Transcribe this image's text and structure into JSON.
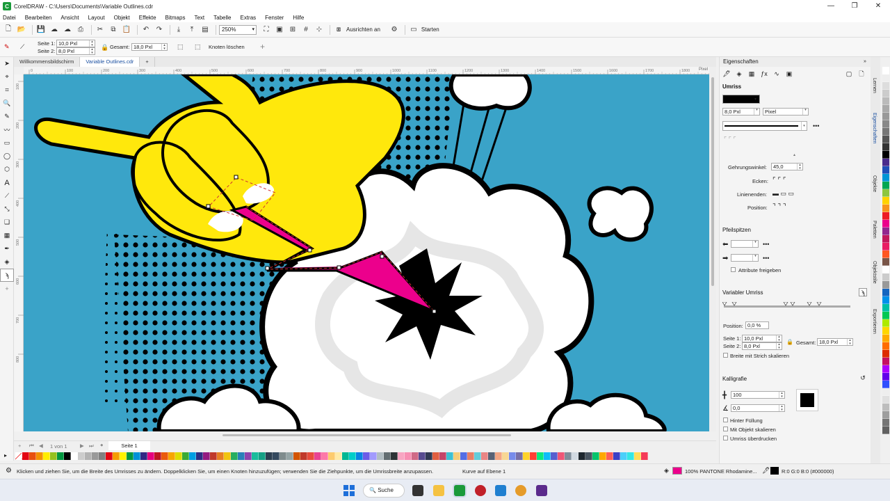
{
  "window": {
    "title": "CorelDRAW - C:\\Users\\Documents\\Variable Outlines.cdr",
    "controls": [
      "—",
      "❐",
      "✕"
    ]
  },
  "menu": [
    "Datei",
    "Bearbeiten",
    "Ansicht",
    "Layout",
    "Objekt",
    "Effekte",
    "Bitmaps",
    "Text",
    "Tabelle",
    "Extras",
    "Fenster",
    "Hilfe"
  ],
  "toolbar": {
    "zoom": "250%",
    "align_label": "Ausrichten an",
    "start_label": "Starten"
  },
  "propbar": {
    "side1_label": "Seite 1:",
    "side1_value": "10,0 Pxl",
    "side2_label": "Seite 2:",
    "side2_value": "8,0 Pxl",
    "total_label": "Gesamt:",
    "total_value": "18,0 Pxl",
    "delete_nodes": "Knoten löschen"
  },
  "tabs": [
    "Willkommensbildschirm",
    "Variable Outlines.cdr"
  ],
  "ruler": {
    "h_ticks": [
      "0",
      "100",
      "200",
      "300",
      "400",
      "500",
      "600",
      "700",
      "800",
      "900",
      "1000",
      "1100",
      "1200",
      "1300",
      "1400",
      "1500",
      "1600",
      "1700",
      "1800",
      "1900"
    ],
    "h_unit": "Pixel",
    "v_ticks": [
      "100",
      "200",
      "300",
      "400",
      "500",
      "600",
      "700",
      "800"
    ]
  },
  "pagebar": {
    "counter": "1 von 1",
    "page_tab": "Seite 1"
  },
  "palette_colors": [
    "#ffffff",
    "#e30613",
    "#e8500f",
    "#f39200",
    "#ffed00",
    "#95c11f",
    "#00963f",
    "#000000",
    "#ffffff",
    "#cccccc",
    "#b3b3b3",
    "#999999",
    "#808080",
    "#e30613",
    "#f59c00",
    "#fff200",
    "#009640",
    "#0090d7",
    "#312783",
    "#e6007e",
    "#be1622",
    "#ea5b0c",
    "#f7a600",
    "#dedc00",
    "#3aaa35",
    "#009fe3",
    "#2d2e83",
    "#951b81",
    "#c0392b",
    "#e67e22",
    "#f1c40f",
    "#27ae60",
    "#2980b9",
    "#8e44ad",
    "#1abc9c",
    "#16a085",
    "#2c3e50",
    "#34495e",
    "#7f8c8d",
    "#95a5a6",
    "#d35400",
    "#c0392b",
    "#e74c3c",
    "#e84393",
    "#fd79a8",
    "#fdcb6e",
    "#ffeaa7",
    "#00b894",
    "#00cec9",
    "#0984e3",
    "#6c5ce7",
    "#a29bfe",
    "#b2bec3",
    "#636e72",
    "#2d3436",
    "#f8a5c2",
    "#f78fb3",
    "#cf6a87",
    "#574b90",
    "#303952",
    "#e15f41",
    "#c44569",
    "#3dc1d3",
    "#f5cd79",
    "#546de5",
    "#e77f67",
    "#63cdda",
    "#ea8685",
    "#596275",
    "#f3a683",
    "#f7d794",
    "#778beb",
    "#786fa6",
    "#ffd32a",
    "#ff3f34",
    "#0be881",
    "#0fbcf9",
    "#575fcf",
    "#ef5777",
    "#808e9b",
    "#d2dae2",
    "#1e272e",
    "#485460",
    "#05c46b",
    "#ffa801",
    "#ff5e57",
    "#3c40c6",
    "#4bcffa",
    "#34e7e4",
    "#ffdd59",
    "#f53b57"
  ],
  "status": {
    "hint": "Klicken und ziehen Sie, um die Breite des Umrisses zu ändern. Doppelklicken Sie, um einen Knoten hinzuzufügen; verwenden Sie die Ziehpunkte, um die Umrissbreite anzupassen.",
    "layer": "Kurve auf Ebene 1",
    "fill": "100% PANTONE Rhodamine...",
    "outline": "R:0 G:0 B:0 (#000000)"
  },
  "taskbar": {
    "search": "Suche"
  },
  "panel": {
    "header": "Eigenschaften",
    "section_outline": "Umriss",
    "width_value": "8,0 Pxl",
    "unit_value": "Pixel",
    "miter_label": "Gehrungswinkel:",
    "miter_value": "45,0",
    "corners_label": "Ecken:",
    "line_ends_label": "Linienenden:",
    "position_label": "Position:",
    "arrows_label": "Pfeilspitzen",
    "release_attr": "Attribute freigeben",
    "var_outline": "Variabler Umriss",
    "position_field_label": "Position:",
    "position_field_value": "0,0 %",
    "side1_label": "Seite 1:",
    "side1_value": "10,0 Pxl",
    "side2_label": "Seite 2:",
    "side2_value": "8,0 Pxl",
    "total_label": "Gesamt:",
    "total_value": "18,0 Pxl",
    "scale_width": "Breite mit Strich skalieren",
    "calligraphy": "Kalligrafie",
    "stretch_value": "100",
    "angle_value": "0,0",
    "behind_fill": "Hinter Füllung",
    "scale_with_object": "Mit Objekt skalieren",
    "overprint": "Umriss überdrucken"
  },
  "side_tabs": [
    "Lernen",
    "Eigenschaften",
    "Objekte",
    "Paletten",
    "Objektstile",
    "Exportieren"
  ],
  "color_strip": [
    "#ffffff",
    "#eeeeee",
    "#dddddd",
    "#cccccc",
    "#bbbbbb",
    "#aaaaaa",
    "#999999",
    "#888888",
    "#777777",
    "#555555",
    "#333333",
    "#000000",
    "#4a2b8c",
    "#1f4fb8",
    "#0096d6",
    "#00a651",
    "#8dc63f",
    "#ffd200",
    "#f7941d",
    "#ed1c24",
    "#ec008c",
    "#92278f",
    "#c2185b",
    "#e91e63",
    "#ff5722",
    "#795548",
    "#ffffff",
    "#cccccc",
    "#999999",
    "#1565c0",
    "#0091ea",
    "#00bfa5",
    "#00c853",
    "#aeea00",
    "#ffd600",
    "#ffab00",
    "#ff6d00",
    "#dd2c00",
    "#c51162",
    "#aa00ff",
    "#6200ea",
    "#304ffe",
    "#eeeeee",
    "#e0e0e0",
    "#bdbdbd",
    "#9e9e9e",
    "#757575",
    "#616161"
  ]
}
